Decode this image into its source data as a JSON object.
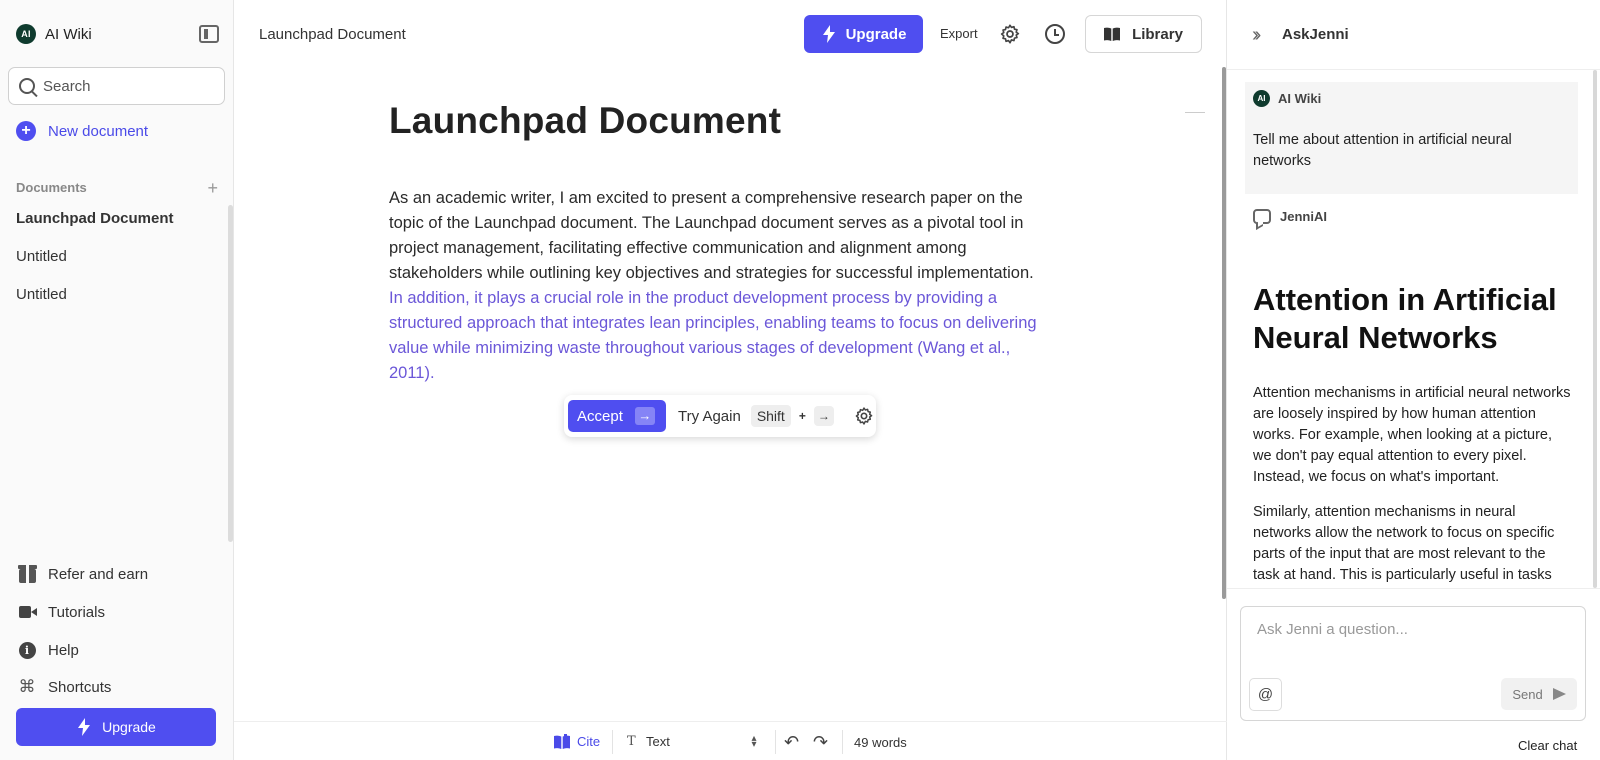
{
  "sidebar": {
    "brand_initials": "AI",
    "brand_name": "AI Wiki",
    "search_placeholder": "Search",
    "new_document": "New document",
    "documents_heading": "Documents",
    "documents": [
      {
        "label": "Launchpad Document",
        "active": true
      },
      {
        "label": "Untitled",
        "active": false
      },
      {
        "label": "Untitled",
        "active": false
      }
    ],
    "links": [
      {
        "label": "Refer and earn",
        "icon": "gift-icon"
      },
      {
        "label": "Tutorials",
        "icon": "video-icon"
      },
      {
        "label": "Help",
        "icon": "info-icon"
      },
      {
        "label": "Shortcuts",
        "icon": "command-icon"
      }
    ],
    "upgrade_label": "Upgrade"
  },
  "header": {
    "doc_title": "Launchpad Document",
    "upgrade_label": "Upgrade",
    "export_label": "Export",
    "library_label": "Library"
  },
  "editor": {
    "title": "Launchpad Document",
    "body_text": "As an academic writer, I am excited to present a comprehensive research paper on the topic of the Launchpad document. The Launchpad document serves as a pivotal tool in project management, facilitating effective communication and alignment among stakeholders while outlining key objectives and strategies for successful implementation. ",
    "suggestion_text": "In addition, it plays a crucial role in the product development process by providing a structured approach that integrates lean principles, enabling teams to focus on delivering value while minimizing waste throughout various stages of development (Wang et al., 2011).",
    "suggestion_bar": {
      "accept_label": "Accept",
      "accept_key": "→",
      "try_again_label": "Try Again",
      "shift_key": "Shift",
      "plus": "+",
      "arrow_key": "→"
    }
  },
  "bottom_bar": {
    "cite_label": "Cite",
    "text_style_glyph": "T",
    "text_style": "Text",
    "word_count": "49 words"
  },
  "right_panel": {
    "title": "AskJenni",
    "user_initials": "AI",
    "user_name": "AI Wiki",
    "user_message": "Tell me about attention in artificial neural networks",
    "bot_name": "JenniAI",
    "answer_title": "Attention in Artificial Neural Networks",
    "answer_p1": "Attention mechanisms in artificial neural networks are loosely inspired by how human attention works. For example, when looking at a picture, we don't pay equal attention to every pixel. Instead, we focus on what's important.",
    "answer_p2": "Similarly, attention mechanisms in neural networks allow the network to focus on specific parts of the input that are most relevant to the task at hand. This is particularly useful in tasks",
    "ask_placeholder": "Ask Jenni a question...",
    "at_label": "@",
    "send_label": "Send",
    "clear_chat_label": "Clear chat"
  },
  "colors": {
    "accent": "#4f4ef0",
    "suggestion": "#6b57d8",
    "brand_badge": "#0f3b2e"
  }
}
